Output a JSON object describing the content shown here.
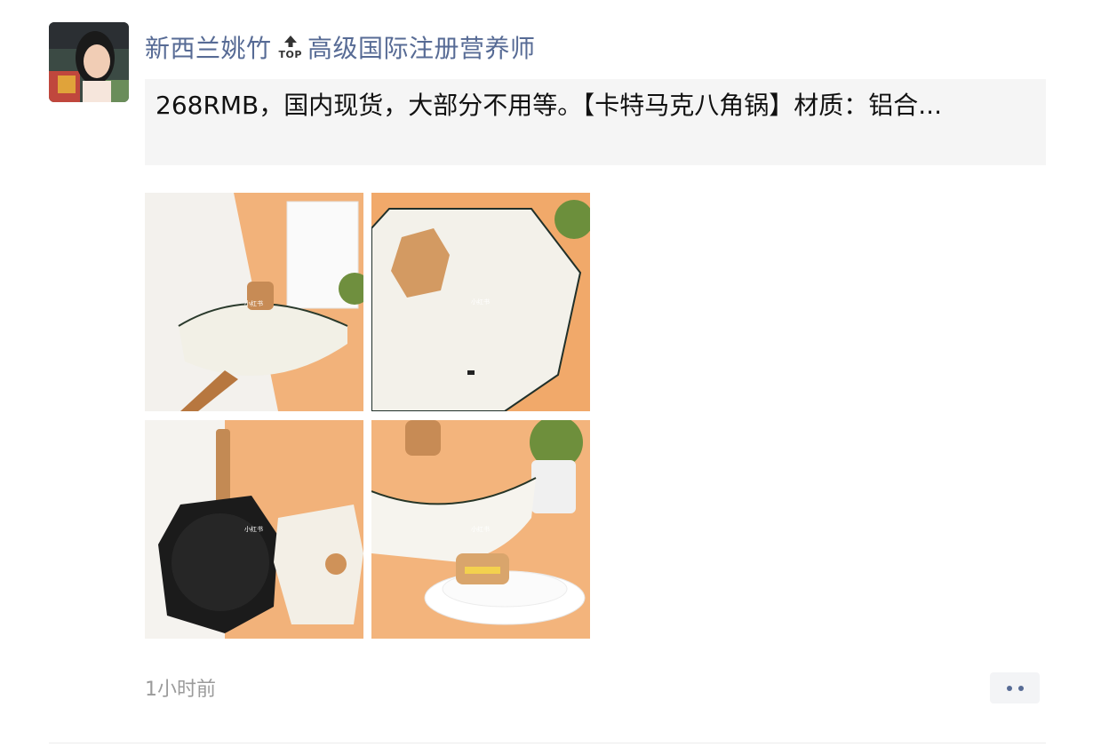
{
  "post": {
    "author": "新西兰姚竹",
    "top_badge": "TOP",
    "title": "高级国际注册营养师",
    "share_text": "268RMB，国内现货，大部分不用等。【卡特马克八角锅】材质：铝合...",
    "photo_watermark": "小红书",
    "time": "1小时前"
  },
  "colors": {
    "name": "#576b95",
    "card_bg": "#f5f5f5",
    "time": "#9b9b9b"
  },
  "icons": {
    "top": "arrow-up-top-icon",
    "more": "more-dots-icon"
  }
}
